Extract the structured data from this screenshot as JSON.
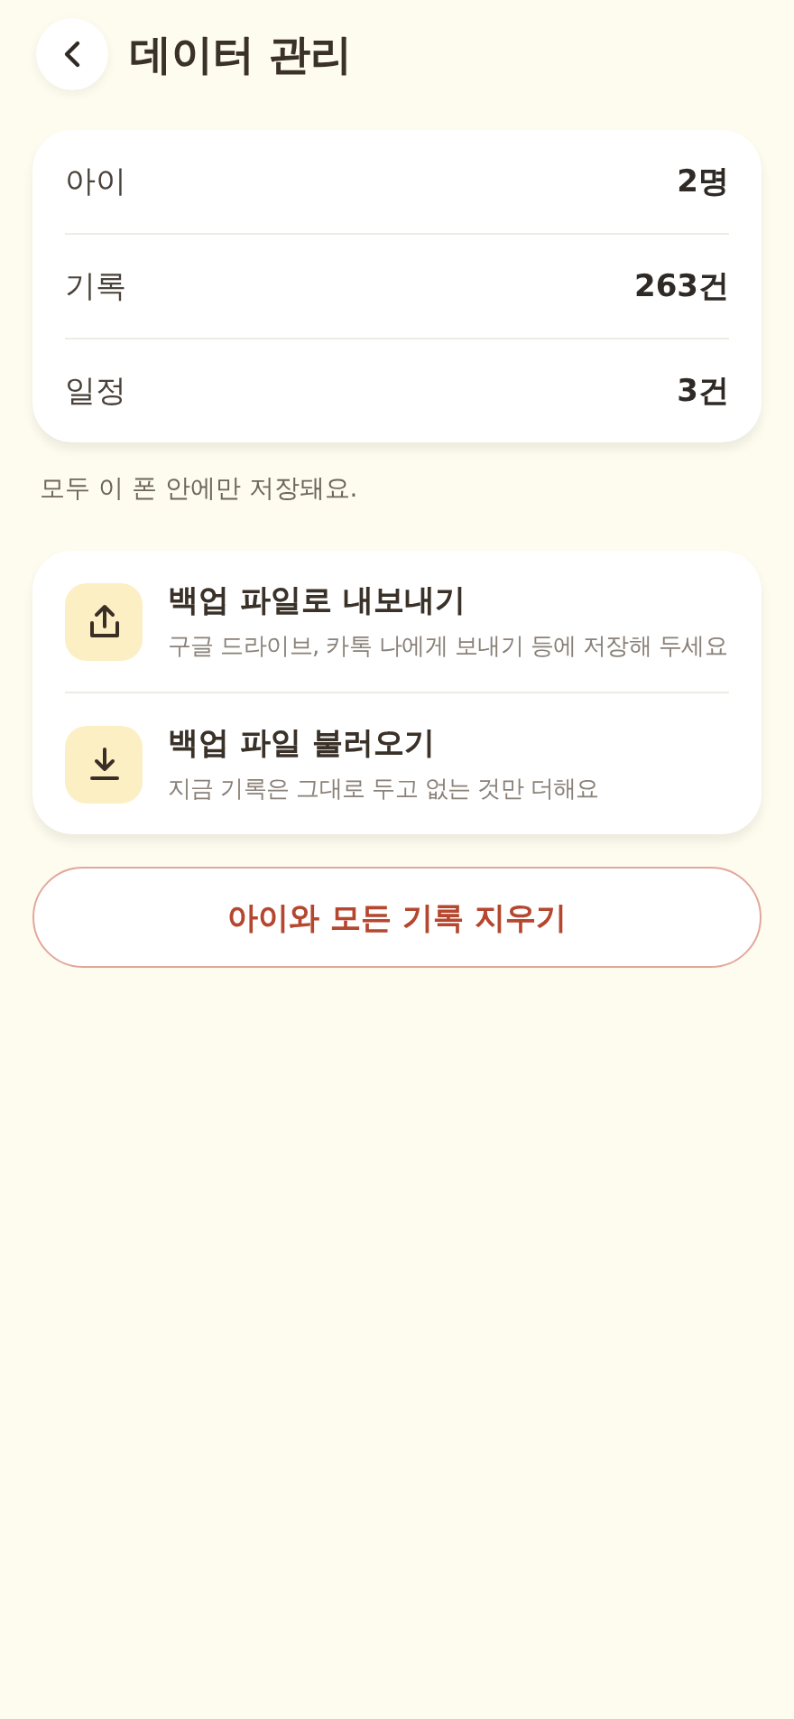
{
  "header": {
    "title": "데이터 관리"
  },
  "stats": [
    {
      "label": "아이",
      "value": "2명"
    },
    {
      "label": "기록",
      "value": "263건"
    },
    {
      "label": "일정",
      "value": "3건"
    }
  ],
  "note": "모두 이 폰 안에만 저장돼요.",
  "actions": [
    {
      "kind": "export",
      "title": "백업 파일로 내보내기",
      "subtitle": "구글 드라이브, 카톡 나에게 보내기 등에 저장해 두세요"
    },
    {
      "kind": "import",
      "title": "백업 파일 불러오기",
      "subtitle": "지금 기록은 그대로 두고 없는 것만 더해요"
    }
  ],
  "danger_button": "아이와 모든 기록 지우기"
}
